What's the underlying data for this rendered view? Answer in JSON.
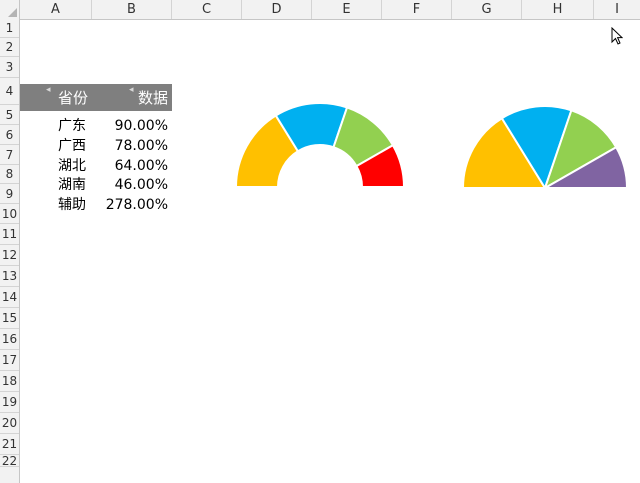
{
  "columns": [
    "A",
    "B",
    "C",
    "D",
    "E",
    "F",
    "G",
    "H",
    "I"
  ],
  "rows": [
    "1",
    "2",
    "3",
    "4",
    "5",
    "6",
    "7",
    "8",
    "9",
    "10",
    "11",
    "12",
    "13",
    "14",
    "15",
    "16",
    "17",
    "18",
    "19",
    "20",
    "21",
    "22"
  ],
  "table": {
    "header": {
      "province": "省份",
      "value": "数据"
    },
    "rows": [
      {
        "province": "广东",
        "value": "90.00%"
      },
      {
        "province": "广西",
        "value": "78.00%"
      },
      {
        "province": "湖北",
        "value": "64.00%"
      },
      {
        "province": "湖南",
        "value": "46.00%"
      },
      {
        "province": "辅助",
        "value": "278.00%"
      }
    ]
  },
  "chart_data": [
    {
      "type": "pie",
      "style": "doughnut-half",
      "categories": [
        "广东",
        "广西",
        "湖北",
        "湖南",
        "辅助"
      ],
      "values": [
        90,
        78,
        64,
        46,
        278
      ],
      "colors": [
        "#ffc000",
        "#00b0f0",
        "#92d050",
        "#ff0000",
        "#ffffff"
      ],
      "hidden_category": "辅助",
      "title": "",
      "legend": "none"
    },
    {
      "type": "pie",
      "style": "pie-half",
      "categories": [
        "广东",
        "广西",
        "湖北",
        "湖南",
        "辅助"
      ],
      "values": [
        90,
        78,
        64,
        46,
        278
      ],
      "colors": [
        "#ffc000",
        "#00b0f0",
        "#92d050",
        "#8064a2",
        "#ffffff"
      ],
      "hidden_category": "辅助",
      "title": "",
      "legend": "none"
    }
  ],
  "cursor_icon": "mouse-pointer-icon"
}
